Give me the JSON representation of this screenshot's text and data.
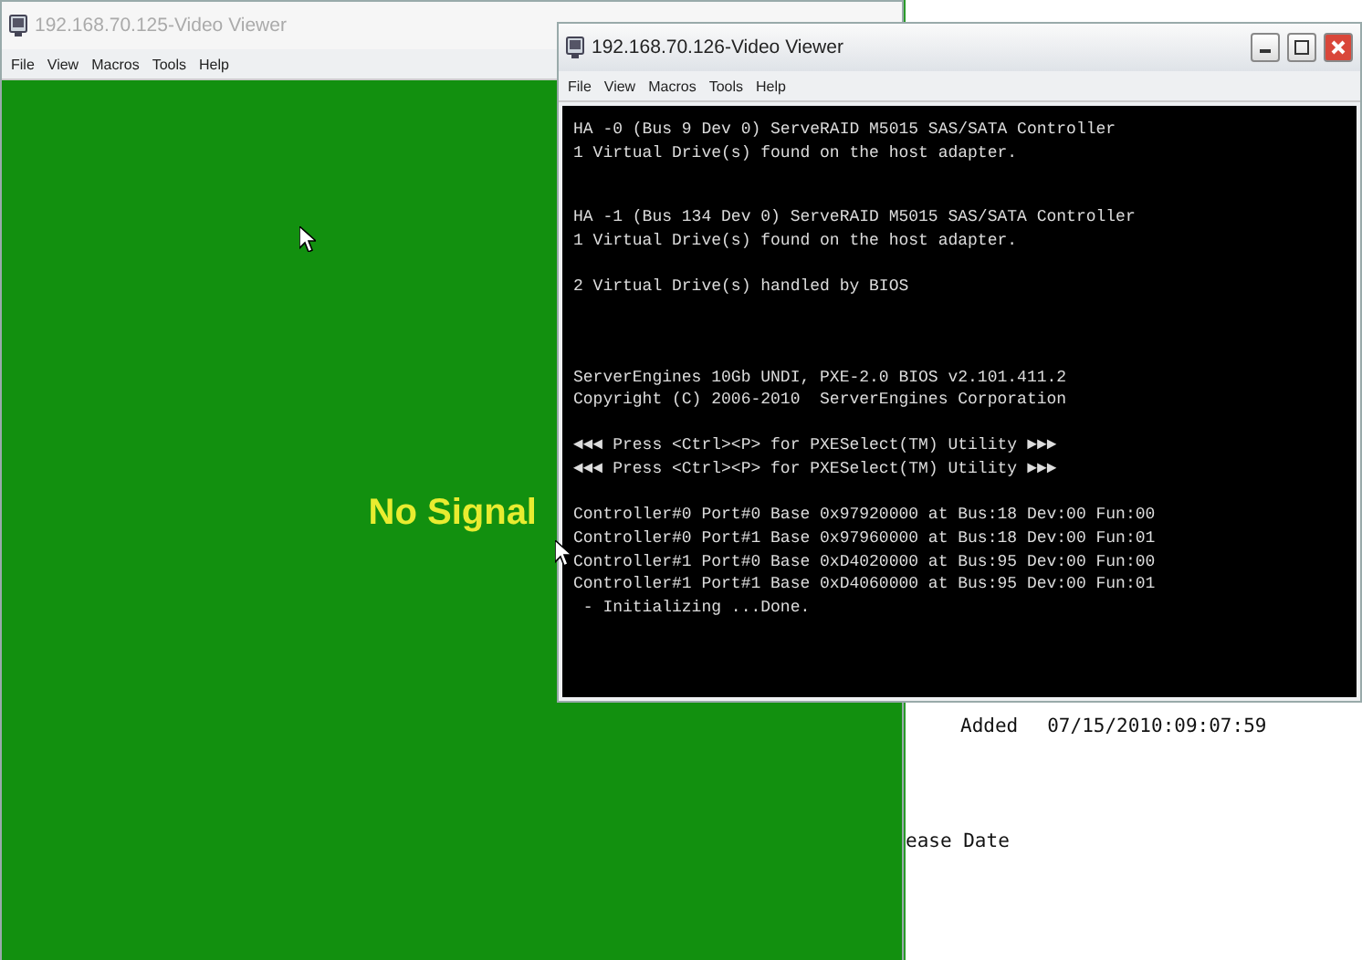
{
  "background_window": {
    "rows": [
      {
        "status": "Added",
        "timestamp": "07/15/2010:09:07:59"
      }
    ],
    "label": "ease Date"
  },
  "windows": [
    {
      "title": "192.168.70.125-Video Viewer",
      "active": false,
      "menu": [
        "File",
        "View",
        "Macros",
        "Tools",
        "Help"
      ],
      "screen": {
        "kind": "no_signal",
        "message": "No Signal"
      }
    },
    {
      "title": "192.168.70.126-Video Viewer",
      "active": true,
      "menu": [
        "File",
        "View",
        "Macros",
        "Tools",
        "Help"
      ],
      "screen": {
        "kind": "console",
        "blocks": [
          {
            "lines": [
              "HA -0 (Bus 9 Dev 0) ServeRAID M5015 SAS/SATA Controller",
              "1 Virtual Drive(s) found on the host adapter."
            ]
          },
          {
            "lines": [
              "HA -1 (Bus 134 Dev 0) ServeRAID M5015 SAS/SATA Controller",
              "1 Virtual Drive(s) found on the host adapter."
            ]
          },
          {
            "lines": [
              "2 Virtual Drive(s) handled by BIOS"
            ]
          },
          {
            "lines": [
              "ServerEngines 10Gb UNDI, PXE-2.0 BIOS v2.101.411.2",
              "Copyright (C) 2006-2010  ServerEngines Corporation"
            ]
          },
          {
            "lines": [
              "◄◄◄ Press <Ctrl><P> for PXESelect(TM) Utility ►►►",
              "◄◄◄ Press <Ctrl><P> for PXESelect(TM) Utility ►►►"
            ]
          },
          {
            "lines": [
              "Controller#0 Port#0 Base 0x97920000 at Bus:18 Dev:00 Fun:00",
              "Controller#0 Port#1 Base 0x97960000 at Bus:18 Dev:00 Fun:01",
              "Controller#1 Port#0 Base 0xD4020000 at Bus:95 Dev:00 Fun:00",
              "Controller#1 Port#1 Base 0xD4060000 at Bus:95 Dev:00 Fun:01",
              " - Initializing ...Done."
            ]
          }
        ]
      }
    }
  ]
}
